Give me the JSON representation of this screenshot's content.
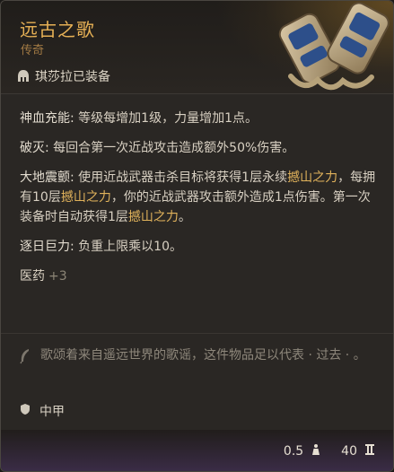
{
  "item": {
    "title": "远古之歌",
    "rarity": "传奇",
    "equipped_text": "琪莎拉已装备"
  },
  "properties": [
    {
      "name": "神血充能:",
      "desc": "等级每增加1级，力量增加1点。"
    },
    {
      "name": "破灭:",
      "desc": "每回合第一次近战攻击造成额外50%伤害。"
    },
    {
      "name": "大地震颤:",
      "desc_parts": [
        "使用近战武器击杀目标将获得1层永续",
        "撼山之力",
        "，每拥有10层",
        "撼山之力",
        "，你的近战武器攻击额外造成1点伤害。第一次装备时自动获得1层",
        "撼山之力",
        "。"
      ]
    },
    {
      "name": "逐日巨力:",
      "desc": "负重上限乘以10。"
    }
  ],
  "category": {
    "label": "医药",
    "value": "+3"
  },
  "lore": "歌颂着来自遥远世界的歌谣，这件物品足以代表 · 过去 · 。",
  "armor_type": "中甲",
  "footer": {
    "weight": "0.5",
    "price": "40"
  },
  "icons": {
    "equipped": "helmet-icon",
    "lore": "feather-icon",
    "armor": "shield-icon",
    "weight": "weight-icon",
    "price": "gold-icon",
    "art": "gauntlets-icon"
  },
  "colors": {
    "title": "#e6b055",
    "highlight": "#e0b25b",
    "rarity": "#a27a44",
    "footer_accent": "#3a2c46"
  }
}
